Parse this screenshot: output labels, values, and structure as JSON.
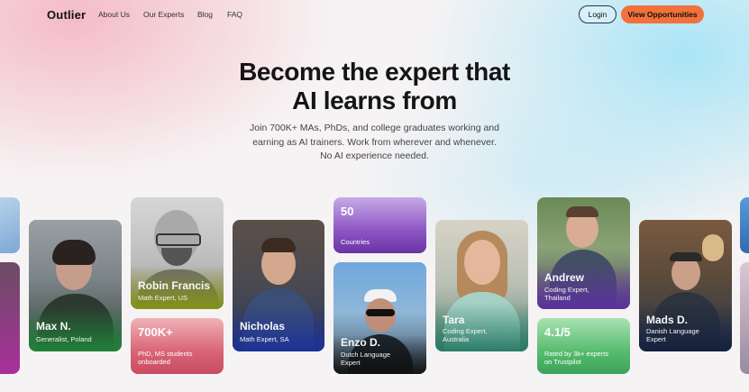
{
  "nav": {
    "logo": "Outlier",
    "links": [
      "About Us",
      "Our Experts",
      "Blog",
      "FAQ"
    ],
    "login_label": "Login",
    "cta_label": "View Opportunities"
  },
  "hero": {
    "title_line1": "Become the expert that",
    "title_line2": "AI learns from",
    "sub_line1": "Join 700K+ MAs, PhDs, and college graduates working and",
    "sub_line2": "earning as AI trainers. Work from wherever and whenever.",
    "sub_line3": "No AI experience needed."
  },
  "experts": [
    {
      "name": "Max N.",
      "role_line1": "Generalist, Poland",
      "role_line2": ""
    },
    {
      "name": "Robin Francis",
      "role_line1": "Math Expert, US",
      "role_line2": ""
    },
    {
      "name": "Nicholas",
      "role_line1": "Math Expert, SA",
      "role_line2": ""
    },
    {
      "name": "Enzo D.",
      "role_line1": "Dutch Language",
      "role_line2": "Expert"
    },
    {
      "name": "Tara",
      "role_line1": "Coding Expert,",
      "role_line2": "Australia"
    },
    {
      "name": "Andrew",
      "role_line1": "Coding Expert,",
      "role_line2": "Thailand"
    },
    {
      "name": "Mads D.",
      "role_line1": "Danish Language",
      "role_line2": "Expert"
    }
  ],
  "stats": [
    {
      "value": "700K+",
      "label_line1": "PhD, MS students",
      "label_line2": "onboarded"
    },
    {
      "value": "50",
      "label_line1": "Countries",
      "label_line2": ""
    },
    {
      "value": "4.1/5",
      "label_line1": "Rated by 3k+ experts",
      "label_line2": "on Trustpilot"
    }
  ],
  "colors": {
    "cta": "#f2703a",
    "login_border": "#1b3a57",
    "green_overlay": "#2f9a46",
    "yellow_overlay": "#9aa51e",
    "blue_overlay": "#1f3c9e",
    "purple_overlay": "#6a3aa8",
    "teal_overlay": "#2e8a73",
    "red_overlay": "#d05a6a"
  }
}
